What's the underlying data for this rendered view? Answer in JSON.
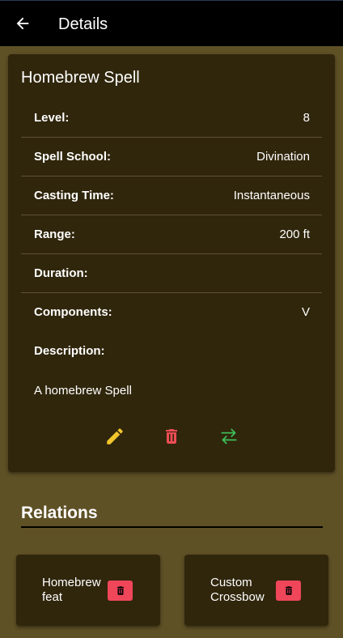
{
  "appbar": {
    "title": "Details",
    "back_icon": "arrow-left-icon"
  },
  "spell": {
    "name": "Homebrew Spell",
    "fields": [
      {
        "label": "Level:",
        "value": "8"
      },
      {
        "label": "Spell School:",
        "value": "Divination"
      },
      {
        "label": "Casting Time:",
        "value": "Instantaneous"
      },
      {
        "label": "Range:",
        "value": "200 ft"
      },
      {
        "label": "Duration:",
        "value": ""
      },
      {
        "label": "Components:",
        "value": "V"
      },
      {
        "label": "Description:",
        "value": ""
      }
    ],
    "description": "A homebrew Spell"
  },
  "actions": [
    {
      "icon": "pencil-icon",
      "color": "#f2c52c"
    },
    {
      "icon": "trash-icon",
      "color": "#ee4d55"
    },
    {
      "icon": "swap-arrows-icon",
      "color": "#3dbf5a"
    }
  ],
  "relations": {
    "title": "Relations",
    "items": [
      {
        "name": "Homebrew feat",
        "delete_icon": "trash-icon"
      },
      {
        "name": "Custom Crossbow",
        "delete_icon": "trash-icon"
      }
    ]
  },
  "colors": {
    "background": "#5f5126",
    "card": "#30260c",
    "appbar": "#000000",
    "delete_button": "#f0465a"
  }
}
